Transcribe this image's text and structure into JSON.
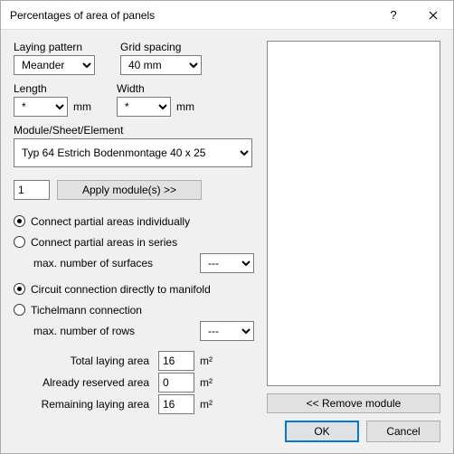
{
  "window": {
    "title": "Percentages of area of panels"
  },
  "form": {
    "laying_pattern": {
      "label": "Laying pattern",
      "value": "Meander"
    },
    "grid_spacing": {
      "label": "Grid spacing",
      "value": "40 mm"
    },
    "length": {
      "label": "Length",
      "value": "*",
      "unit": "mm"
    },
    "width": {
      "label": "Width",
      "value": "*",
      "unit": "mm"
    },
    "module": {
      "label": "Module/Sheet/Element",
      "value": "Typ 64 Estrich Bodenmontage  40 x  25"
    },
    "apply_count": "1",
    "apply_btn": "Apply module(s) >>",
    "radios_partial": {
      "individually": "Connect partial areas individually",
      "series": "Connect partial areas in series",
      "selected": "individually"
    },
    "max_surfaces": {
      "label": "max. number of surfaces",
      "value": "---"
    },
    "radios_circuit": {
      "direct": "Circuit connection directly to manifold",
      "tichelmann": "Tichelmann connection",
      "selected": "direct"
    },
    "max_rows": {
      "label": "max. number of rows",
      "value": "---"
    },
    "stats": {
      "total": {
        "label": "Total laying area",
        "value": "16",
        "unit": "m²"
      },
      "reserved": {
        "label": "Already reserved area",
        "value": "0",
        "unit": "m²"
      },
      "remaining": {
        "label": "Remaining laying area",
        "value": "16",
        "unit": "m²"
      }
    }
  },
  "right": {
    "remove_btn": "<< Remove module"
  },
  "footer": {
    "ok": "OK",
    "cancel": "Cancel"
  }
}
